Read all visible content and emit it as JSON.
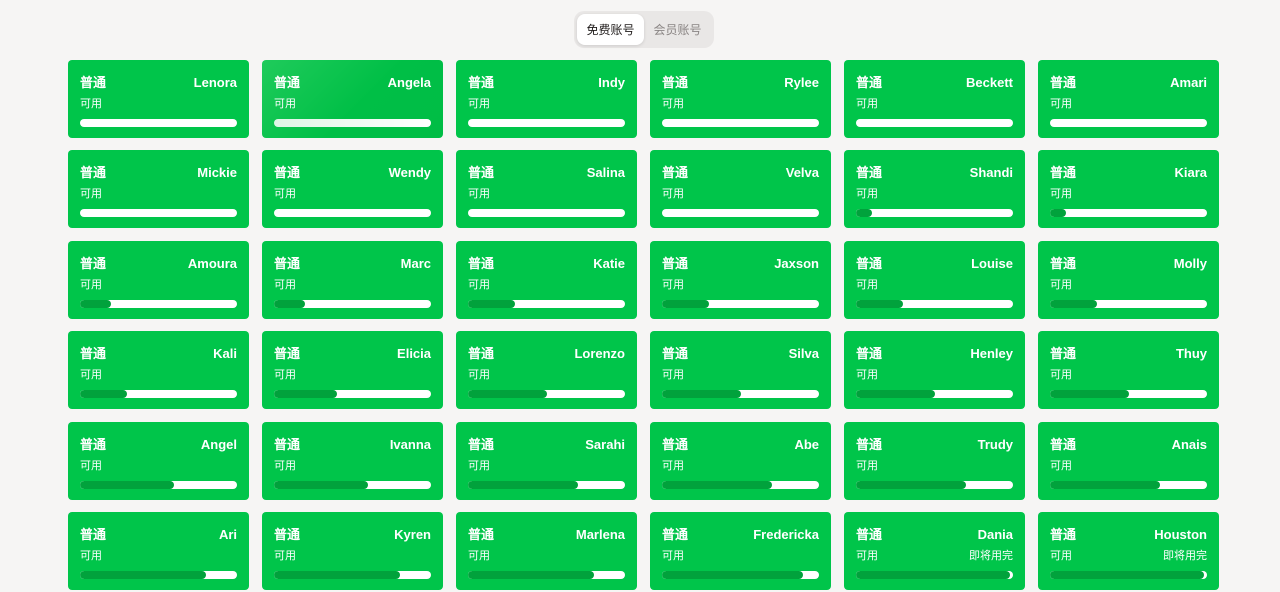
{
  "tabs": [
    {
      "label": "免费账号",
      "active": true
    },
    {
      "label": "会员账号",
      "active": false
    }
  ],
  "colors": {
    "card": "#00c54a",
    "bar_track": "#ffffff",
    "bar_fill": "#01a23c",
    "page_bg": "#f6f5f4"
  },
  "accounts": [
    {
      "type": "普通",
      "name": "Lenora",
      "status": "可用",
      "note": "",
      "usage": 0
    },
    {
      "type": "普通",
      "name": "Angela",
      "status": "可用",
      "note": "",
      "usage": 0
    },
    {
      "type": "普通",
      "name": "Indy",
      "status": "可用",
      "note": "",
      "usage": 0
    },
    {
      "type": "普通",
      "name": "Rylee",
      "status": "可用",
      "note": "",
      "usage": 0
    },
    {
      "type": "普通",
      "name": "Beckett",
      "status": "可用",
      "note": "",
      "usage": 0
    },
    {
      "type": "普通",
      "name": "Amari",
      "status": "可用",
      "note": "",
      "usage": 0
    },
    {
      "type": "普通",
      "name": "Mickie",
      "status": "可用",
      "note": "",
      "usage": 0
    },
    {
      "type": "普通",
      "name": "Wendy",
      "status": "可用",
      "note": "",
      "usage": 0
    },
    {
      "type": "普通",
      "name": "Salina",
      "status": "可用",
      "note": "",
      "usage": 0
    },
    {
      "type": "普通",
      "name": "Velva",
      "status": "可用",
      "note": "",
      "usage": 0
    },
    {
      "type": "普通",
      "name": "Shandi",
      "status": "可用",
      "note": "",
      "usage": 0.1
    },
    {
      "type": "普通",
      "name": "Kiara",
      "status": "可用",
      "note": "",
      "usage": 0.1
    },
    {
      "type": "普通",
      "name": "Amoura",
      "status": "可用",
      "note": "",
      "usage": 0.2
    },
    {
      "type": "普通",
      "name": "Marc",
      "status": "可用",
      "note": "",
      "usage": 0.2
    },
    {
      "type": "普通",
      "name": "Katie",
      "status": "可用",
      "note": "",
      "usage": 0.3
    },
    {
      "type": "普通",
      "name": "Jaxson",
      "status": "可用",
      "note": "",
      "usage": 0.3
    },
    {
      "type": "普通",
      "name": "Louise",
      "status": "可用",
      "note": "",
      "usage": 0.3
    },
    {
      "type": "普通",
      "name": "Molly",
      "status": "可用",
      "note": "",
      "usage": 0.3
    },
    {
      "type": "普通",
      "name": "Kali",
      "status": "可用",
      "note": "",
      "usage": 0.3
    },
    {
      "type": "普通",
      "name": "Elicia",
      "status": "可用",
      "note": "",
      "usage": 0.4
    },
    {
      "type": "普通",
      "name": "Lorenzo",
      "status": "可用",
      "note": "",
      "usage": 0.5
    },
    {
      "type": "普通",
      "name": "Silva",
      "status": "可用",
      "note": "",
      "usage": 0.5
    },
    {
      "type": "普通",
      "name": "Henley",
      "status": "可用",
      "note": "",
      "usage": 0.5
    },
    {
      "type": "普通",
      "name": "Thuy",
      "status": "可用",
      "note": "",
      "usage": 0.5
    },
    {
      "type": "普通",
      "name": "Angel",
      "status": "可用",
      "note": "",
      "usage": 0.6
    },
    {
      "type": "普通",
      "name": "Ivanna",
      "status": "可用",
      "note": "",
      "usage": 0.6
    },
    {
      "type": "普通",
      "name": "Sarahi",
      "status": "可用",
      "note": "",
      "usage": 0.7
    },
    {
      "type": "普通",
      "name": "Abe",
      "status": "可用",
      "note": "",
      "usage": 0.7
    },
    {
      "type": "普通",
      "name": "Trudy",
      "status": "可用",
      "note": "",
      "usage": 0.7
    },
    {
      "type": "普通",
      "name": "Anais",
      "status": "可用",
      "note": "",
      "usage": 0.7
    },
    {
      "type": "普通",
      "name": "Ari",
      "status": "可用",
      "note": "",
      "usage": 0.8
    },
    {
      "type": "普通",
      "name": "Kyren",
      "status": "可用",
      "note": "",
      "usage": 0.8
    },
    {
      "type": "普通",
      "name": "Marlena",
      "status": "可用",
      "note": "",
      "usage": 0.8
    },
    {
      "type": "普通",
      "name": "Fredericka",
      "status": "可用",
      "note": "",
      "usage": 0.9
    },
    {
      "type": "普通",
      "name": "Dania",
      "status": "可用",
      "note": "即将用完",
      "usage": 0.98
    },
    {
      "type": "普通",
      "name": "Houston",
      "status": "可用",
      "note": "即将用完",
      "usage": 0.98
    }
  ]
}
